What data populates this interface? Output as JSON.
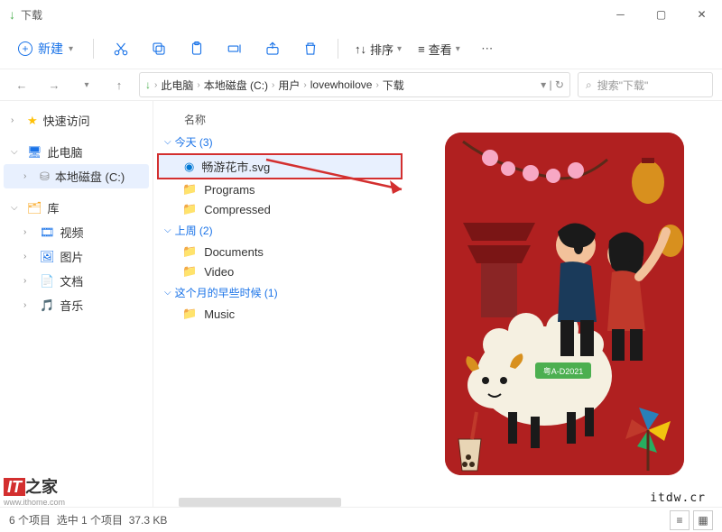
{
  "titlebar": {
    "title": "下载"
  },
  "toolbar": {
    "new_label": "新建",
    "sort_label": "排序",
    "view_label": "查看"
  },
  "breadcrumb": {
    "items": [
      "此电脑",
      "本地磁盘 (C:)",
      "用户",
      "lovewhoilove",
      "下载"
    ]
  },
  "search": {
    "placeholder": "搜索\"下载\""
  },
  "sidebar": {
    "quick_access": "快速访问",
    "this_pc": "此电脑",
    "drive_c": "本地磁盘 (C:)",
    "libraries": "库",
    "video": "视频",
    "pictures": "图片",
    "documents": "文档",
    "music": "音乐"
  },
  "filelist": {
    "col_name": "名称",
    "groups": [
      {
        "label": "今天 (3)",
        "items": [
          {
            "name": "畅游花市.svg",
            "type": "edge",
            "selected": true
          },
          {
            "name": "Programs",
            "type": "folder"
          },
          {
            "name": "Compressed",
            "type": "folder"
          }
        ]
      },
      {
        "label": "上周 (2)",
        "items": [
          {
            "name": "Documents",
            "type": "folder"
          },
          {
            "name": "Video",
            "type": "folder"
          }
        ]
      },
      {
        "label": "这个月的早些时候 (1)",
        "items": [
          {
            "name": "Music",
            "type": "folder"
          }
        ]
      }
    ]
  },
  "statusbar": {
    "count": "6 个项目",
    "selected": "选中 1 个项目",
    "size": "37.3 KB"
  },
  "watermark": {
    "it": "IT",
    "home": "之家",
    "url": "www.ithome.com",
    "itdw": "itdw.cr"
  },
  "preview": {
    "plate": "粤A-D2021"
  }
}
